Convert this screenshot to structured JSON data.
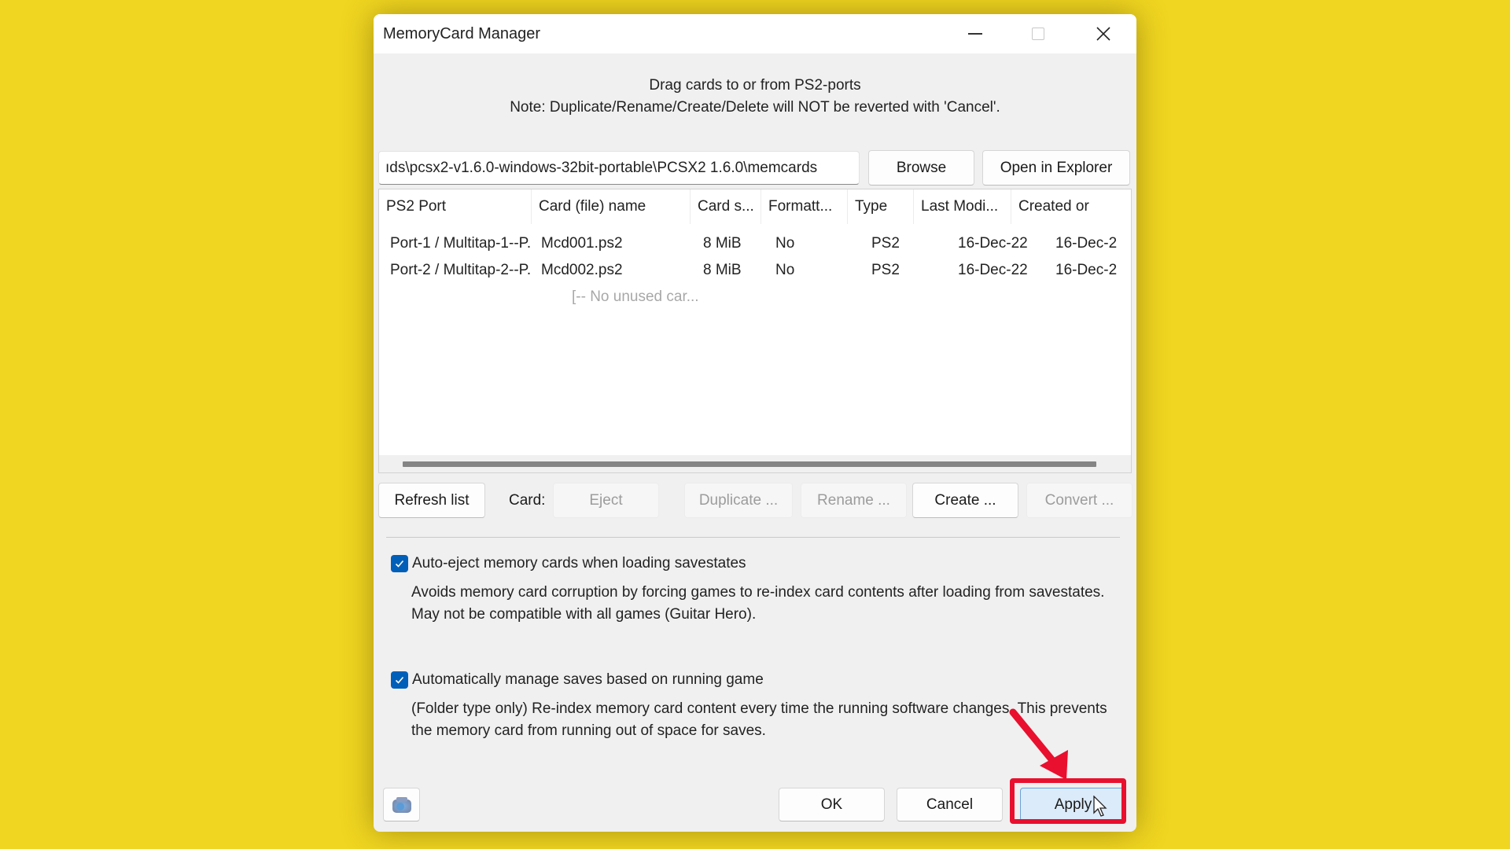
{
  "window": {
    "title": "MemoryCard Manager",
    "controls": {
      "minimize": "minimize-icon",
      "maximize": "maximize-icon",
      "close": "close-icon"
    }
  },
  "header": {
    "line1": "Drag cards to or from PS2-ports",
    "line2": "Note: Duplicate/Rename/Create/Delete will NOT be reverted with 'Cancel'."
  },
  "path": {
    "value": "ıds\\pcsx2-v1.6.0-windows-32bit-portable\\PCSX2 1.6.0\\memcards",
    "browse_label": "Browse",
    "explorer_label": "Open in Explorer"
  },
  "list": {
    "columns": [
      "PS2 Port",
      "Card (file) name",
      "Card s...",
      "Formatt...",
      "Type",
      "Last Modi...",
      "Created or"
    ],
    "rows": [
      [
        "Port-1 / Multitap-1--P...",
        "Mcd001.ps2",
        "8 MiB",
        "No",
        "PS2",
        "16-Dec-22",
        "16-Dec-2"
      ],
      [
        "Port-2 / Multitap-2--P...",
        "Mcd002.ps2",
        "8 MiB",
        "No",
        "PS2",
        "16-Dec-22",
        "16-Dec-2"
      ]
    ],
    "empty_row": "[-- No unused car..."
  },
  "actions": {
    "refresh_label": "Refresh list",
    "card_label": "Card:",
    "eject_label": "Eject",
    "duplicate_label": "Duplicate ...",
    "rename_label": "Rename ...",
    "create_label": "Create ...",
    "convert_label": "Convert ..."
  },
  "options": [
    {
      "label": "Auto-eject memory cards when loading savestates",
      "checked": true,
      "description": "Avoids memory card corruption by forcing games to re-index card contents after loading from savestates.  May not be compatible with all games (Guitar Hero)."
    },
    {
      "label": "Automatically manage saves based on running game",
      "checked": true,
      "description": "(Folder type only) Re-index memory card content every time the running software changes. This prevents the memory card from running out of space for saves."
    }
  ],
  "footer": {
    "ok_label": "OK",
    "cancel_label": "Cancel",
    "apply_label": "Apply"
  },
  "annotation": {
    "color": "#e8102e",
    "target": "Apply"
  },
  "colors": {
    "background": "#f0d620",
    "accent": "#005fb8"
  }
}
